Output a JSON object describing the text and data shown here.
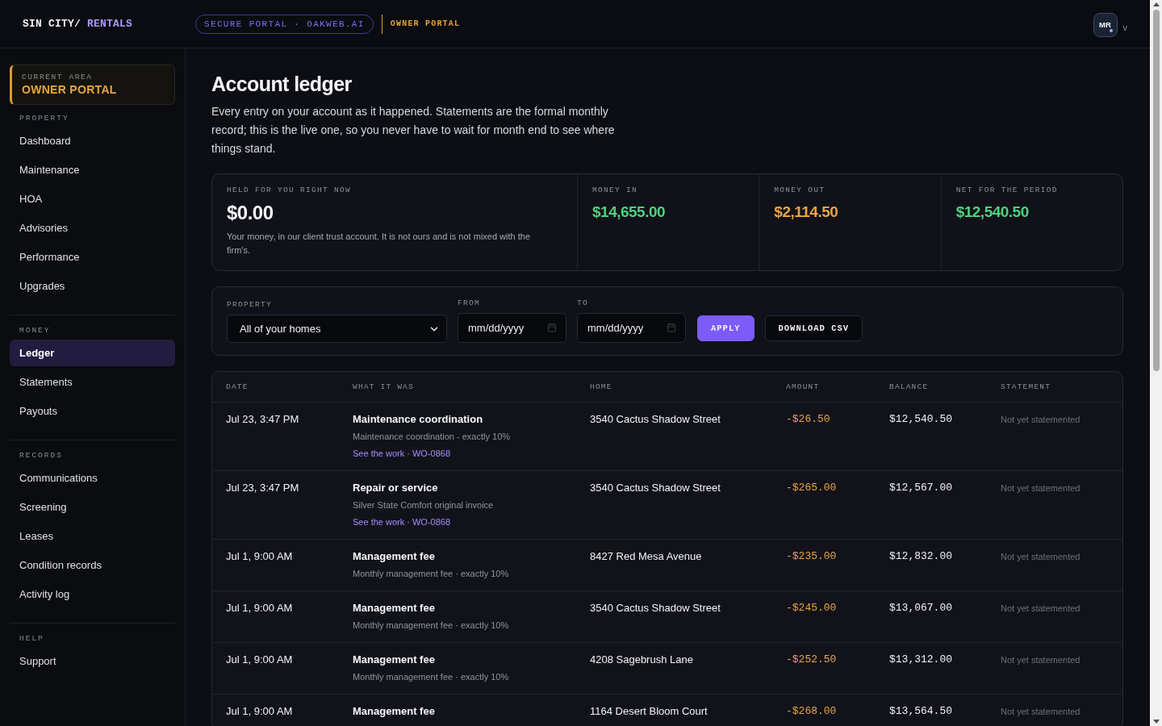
{
  "header": {
    "logo": {
      "primary": "SIN CITY/",
      "accent": "RENTALS"
    },
    "portal_badge": "SECURE PORTAL · OAKWEB.AI",
    "area_label": "OWNER PORTAL",
    "avatar": {
      "initials": "MR",
      "caret": "v"
    }
  },
  "sidebar": {
    "current_area": {
      "label": "CURRENT AREA",
      "value": "OWNER PORTAL"
    },
    "sections": [
      {
        "title": "PROPERTY",
        "items": [
          {
            "label": "Dashboard",
            "selected": false
          },
          {
            "label": "Maintenance",
            "selected": false
          },
          {
            "label": "HOA",
            "selected": false
          },
          {
            "label": "Advisories",
            "selected": false
          },
          {
            "label": "Performance",
            "selected": false
          },
          {
            "label": "Upgrades",
            "selected": false
          }
        ]
      },
      {
        "title": "MONEY",
        "items": [
          {
            "label": "Ledger",
            "selected": true
          },
          {
            "label": "Statements",
            "selected": false
          },
          {
            "label": "Payouts",
            "selected": false
          }
        ]
      },
      {
        "title": "RECORDS",
        "items": [
          {
            "label": "Communications",
            "selected": false
          },
          {
            "label": "Screening",
            "selected": false
          },
          {
            "label": "Leases",
            "selected": false
          },
          {
            "label": "Condition records",
            "selected": false
          },
          {
            "label": "Activity log",
            "selected": false
          }
        ]
      },
      {
        "title": "HELP",
        "items": [
          {
            "label": "Support",
            "selected": false
          }
        ]
      }
    ]
  },
  "page": {
    "title": "Account ledger",
    "description": "Every entry on your account as it happened. Statements are the formal monthly record; this is the live one, so you never have to wait for month end to see where things stand."
  },
  "summary": [
    {
      "kind": "held",
      "label": "HELD FOR YOU RIGHT NOW",
      "value": "$0.00",
      "color": "#f5f6f8",
      "note": "Your money, in our client trust account. It is not ours and is not mixed with the firm's."
    },
    {
      "kind": "total",
      "label": "MONEY IN",
      "value": "$14,655.00",
      "color": "#4ed27c"
    },
    {
      "kind": "total",
      "label": "MONEY OUT",
      "value": "$2,114.50",
      "color": "#e9a446"
    },
    {
      "kind": "total",
      "label": "NET FOR THE PERIOD",
      "value": "$12,540.50",
      "color": "#4ed27c"
    }
  ],
  "filters": {
    "property": {
      "label": "PROPERTY",
      "value": "All of your homes"
    },
    "from": {
      "label": "FROM",
      "placeholder": "mm/dd/yyyy"
    },
    "to": {
      "label": "TO",
      "placeholder": "mm/dd/yyyy"
    },
    "buttons": [
      {
        "kind": "primary",
        "label": "APPLY"
      },
      {
        "kind": "secondary",
        "label": "DOWNLOAD CSV"
      }
    ]
  },
  "table": {
    "columns": [
      "DATE",
      "WHAT IT WAS",
      "HOME",
      "AMOUNT",
      "BALANCE",
      "STATEMENT"
    ],
    "rows": [
      {
        "date": "Jul 23, 3:47 PM",
        "title": "Maintenance coordination",
        "detail": "Maintenance coordination - exactly 10%",
        "link": "See the work · WO-0868",
        "home": "3540 Cactus Shadow Street",
        "amount": "-$26.50",
        "balance": "$12,540.50",
        "statement": "Not yet statemented"
      },
      {
        "date": "Jul 23, 3:47 PM",
        "title": "Repair or service",
        "detail": "Silver State Comfort original invoice",
        "link": "See the work · WO-0868",
        "home": "3540 Cactus Shadow Street",
        "amount": "-$265.00",
        "balance": "$12,567.00",
        "statement": "Not yet statemented"
      },
      {
        "date": "Jul 1, 9:00 AM",
        "title": "Management fee",
        "detail": "Monthly management fee · exactly 10%",
        "home": "8427 Red Mesa Avenue",
        "amount": "-$235.00",
        "balance": "$12,832.00",
        "statement": "Not yet statemented"
      },
      {
        "date": "Jul 1, 9:00 AM",
        "title": "Management fee",
        "detail": "Monthly management fee · exactly 10%",
        "home": "3540 Cactus Shadow Street",
        "amount": "-$245.00",
        "balance": "$13,067.00",
        "statement": "Not yet statemented"
      },
      {
        "date": "Jul 1, 9:00 AM",
        "title": "Management fee",
        "detail": "Monthly management fee · exactly 10%",
        "home": "4208 Sagebrush Lane",
        "amount": "-$252.50",
        "balance": "$13,312.00",
        "statement": "Not yet statemented"
      },
      {
        "date": "Jul 1, 9:00 AM",
        "title": "Management fee",
        "home": "1164 Desert Bloom Court",
        "amount": "-$268.00",
        "balance": "$13,564.50",
        "statement": "Not yet statemented"
      }
    ]
  }
}
